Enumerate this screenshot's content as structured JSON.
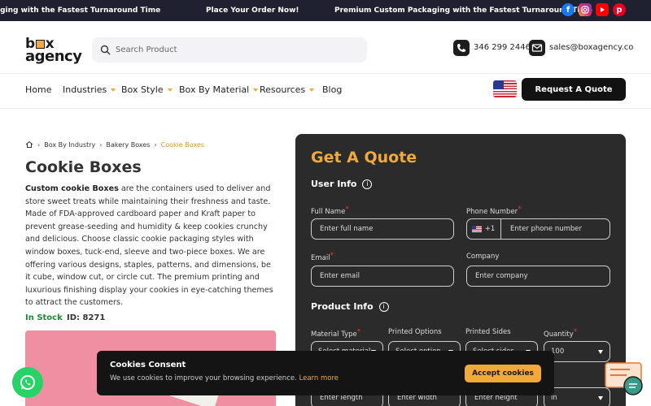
{
  "topbar": {
    "messages": [
      "aging with the Fastest Turnaround Time",
      "Place Your Order Now!",
      "Premium Custom Packaging with the Fastest Turnaround Time"
    ],
    "social_icons": [
      "facebook-icon",
      "instagram-icon",
      "youtube-icon",
      "pinterest-icon"
    ]
  },
  "header": {
    "logo_line1": "b x",
    "logo_line2": "agency",
    "search_placeholder": "Search Product",
    "phone": "346 299 2446",
    "email": "sales@boxagency.co"
  },
  "nav": {
    "items": [
      {
        "label": "Home",
        "dropdown": false
      },
      {
        "label": "Industries",
        "dropdown": true
      },
      {
        "label": "Box Style",
        "dropdown": true
      },
      {
        "label": "Box By Material",
        "dropdown": true
      },
      {
        "label": "Resources",
        "dropdown": true
      },
      {
        "label": "Blog",
        "dropdown": false
      }
    ],
    "cta": "Request A Quote"
  },
  "breadcrumb": [
    "Box By Industry",
    "Bakery Boxes",
    "Cookie Boxes"
  ],
  "product": {
    "title": "Cookie Boxes",
    "desc_bold": "Custom cookie Boxes",
    "desc_rest": " are the containers used to deliver and store sweet treats while maintaining their freshness and taste. Made of FDA-approved cardboard paper and Kraft paper to prevent grease-seeding and humidity & keep cookies crunchy and delicious. Choose classic cookie packaging styles with window boxes, tuck-end, sleeve and two-piece boxes. We are offering various designs, staples, patterns, and dimensions, be it cube, window cut, or circle cut. The premium printing  and luxurious finishing display your cookies in eye-catching themes to attract the customers.",
    "stock": "In Stock",
    "id": "ID: 8271"
  },
  "quote": {
    "title": "Get A Quote",
    "user_info": "User Info",
    "product_info": "Product Info",
    "full_name_label": "Full Name",
    "full_name_ph": "Enter full name",
    "phone_label": "Phone Number",
    "phone_cc": "+1",
    "phone_ph": "Enter phone number",
    "email_label": "Email",
    "email_ph": "Enter email",
    "company_label": "Company",
    "company_ph": "Enter company",
    "material_label": "Material Type",
    "material_value": "Select material",
    "printed_options_label": "Printed Options",
    "printed_options_value": "Select option",
    "printed_sides_label": "Printed Sides",
    "printed_sides_value": "Select sides",
    "quantity_label": "Quantity",
    "quantity_value": "100",
    "length_ph": "Enter length",
    "width_ph": "Enter width",
    "height_ph": "Enter height",
    "unit_value": "in"
  },
  "cookie": {
    "title": "Cookies Consent",
    "text": "We use cookies to improve your browsing experience.",
    "link": "Learn more",
    "accept": "Accept cookies"
  },
  "colors": {
    "accent": "#f2a93b",
    "dark": "#1f2130",
    "panel": "#2b2b2b",
    "stock_green": "#1b8a3a",
    "whatsapp": "#25d366"
  }
}
